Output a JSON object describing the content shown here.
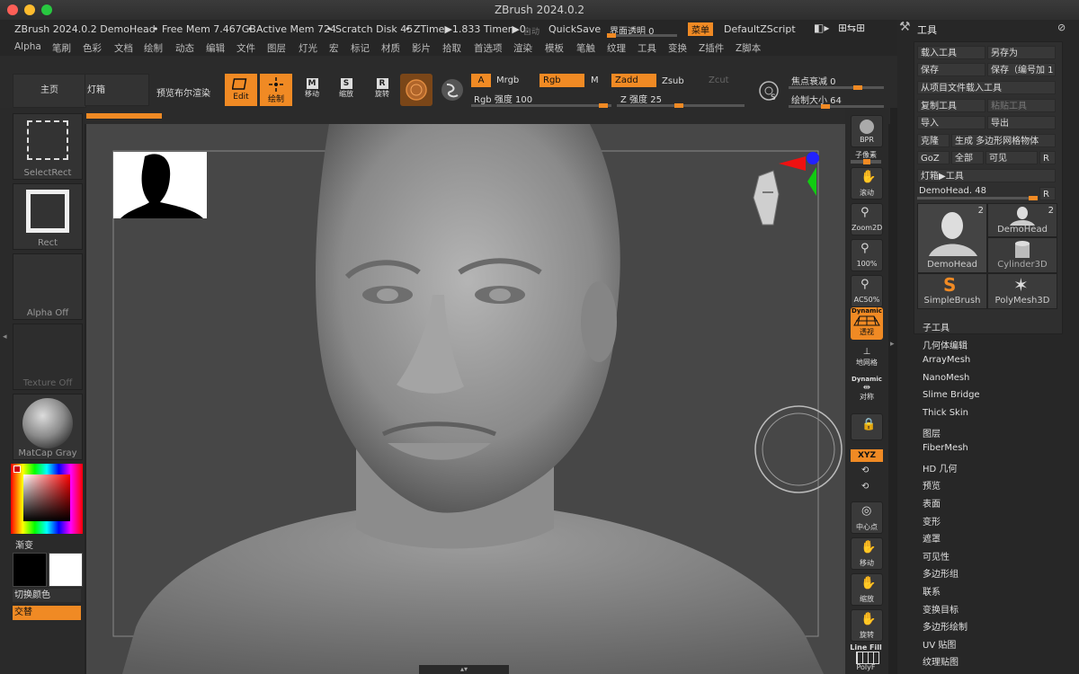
{
  "window": {
    "title": "ZBrush 2024.0.2"
  },
  "status": {
    "doc": "ZBrush 2024.0.2 DemoHead",
    "free_mem": "• Free Mem 7.467GB",
    "active_mem": "• Active Mem 724",
    "scratch": "• Scratch Disk 45",
    "ztime": "• ZTime▶1.833 Timer▶0.",
    "auto": "自动",
    "quicksave": "QuickSave",
    "transparency": "界面透明 0",
    "menu_btn": "菜单",
    "zscript": "DefaultZScript"
  },
  "menu": [
    "Alpha",
    "笔刷",
    "色彩",
    "文档",
    "绘制",
    "动态",
    "编辑",
    "文件",
    "图层",
    "灯光",
    "宏",
    "标记",
    "材质",
    "影片",
    "拾取",
    "首选项",
    "渲染",
    "模板",
    "笔触",
    "纹理",
    "工具",
    "变换",
    "Z插件",
    "Z脚本"
  ],
  "toolbar": {
    "home": "主页",
    "lightbox": "灯箱",
    "bool_render": "预览布尔渲染",
    "edit": "Edit",
    "draw": "绘制",
    "move": "移动",
    "scale": "缩放",
    "rotate": "旋转",
    "a": "A",
    "mrgb": "Mrgb",
    "rgb": "Rgb",
    "m": "M",
    "zadd": "Zadd",
    "zsub": "Zsub",
    "zcut": "Zcut",
    "rgb_intensity": "Rgb 强度 100",
    "z_intensity": "Z 强度 25",
    "focal_shift": "焦点衰减 0",
    "draw_size": "绘制大小 64"
  },
  "left": {
    "selectrect": "SelectRect",
    "rect": "Rect",
    "alpha_off": "Alpha Off",
    "texture_off": "Texture Off",
    "matcap": "MatCap Gray",
    "gradient": "渐变",
    "switch_color": "切换颜色",
    "alternate": "交替"
  },
  "shelf": [
    "BPR",
    "子像素",
    "滚动",
    "Zoom2D",
    "100%",
    "AC50%",
    "Dynamic",
    "透视",
    "地网格",
    "Dynamic",
    "对称",
    "XYZ",
    "中心点",
    "移动",
    "缩放",
    "旋转",
    "Line Fill",
    "PolyF"
  ],
  "panel": {
    "title": "工具",
    "load_tool": "载入工具",
    "save_as": "另存为",
    "save": "保存",
    "save_inc": "保存（编号加 1",
    "load_project": "从项目文件载入工具",
    "copy_tool": "复制工具",
    "paste_tool": "粘贴工具",
    "import": "导入",
    "export": "导出",
    "clone": "克隆",
    "make_poly": "生成 多边形网格物体",
    "goz": "GoZ",
    "all": "全部",
    "visible": "可见",
    "r": "R",
    "lightbox_tools": "灯箱▶工具",
    "tool_slider": "DemoHead. 48",
    "thumbs": [
      {
        "label": "DemoHead",
        "count": "2"
      },
      {
        "label": "DemoHead",
        "count": "2"
      },
      {
        "label": "Cylinder3D",
        "count": ""
      },
      {
        "label": "SimpleBrush",
        "count": ""
      },
      {
        "label": "PolyMesh3D",
        "count": ""
      }
    ],
    "list": [
      "子工具",
      "几何体编辑",
      "ArrayMesh",
      "NanoMesh",
      "Slime Bridge",
      "Thick Skin",
      "图层",
      "FiberMesh",
      "HD 几何",
      "预览",
      "表面",
      "变形",
      "遮罩",
      "可见性",
      "多边形组",
      "联系",
      "变换目标",
      "多边形绘制",
      "UV 贴图",
      "纹理贴图"
    ]
  }
}
